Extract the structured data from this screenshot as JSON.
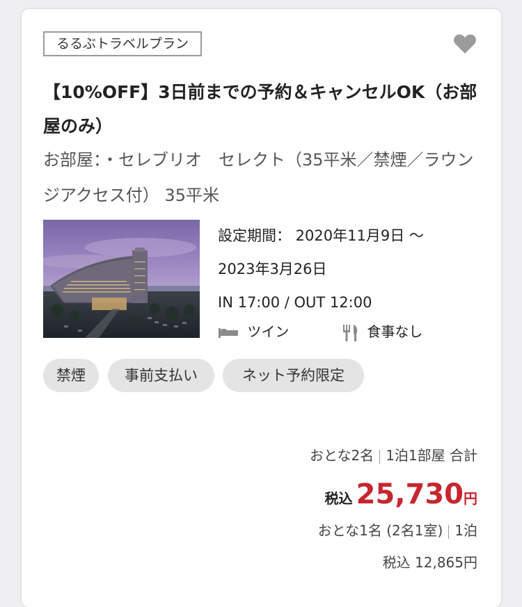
{
  "plan": {
    "tag": "るるぶトラベルプラン",
    "title": "【10%OFF】3日前までの予約＆キャンセルOK（お部屋のみ）",
    "room": "お部屋：・セレブリオ　セレクト（35平米／禁煙／ラウンジアクセス付） 35平米",
    "period_line1": "設定期間： 2020年11月9日 〜",
    "period_line2": "2023年3月26日",
    "checkin_out": "IN 17:00 / OUT 12:00",
    "bed_icon": "bed-icon",
    "bed_label": "ツイン",
    "meal_icon": "fork-knife-icon",
    "meal_label": "食事なし",
    "chips": [
      "禁煙",
      "事前支払い",
      "ネット予約限定"
    ]
  },
  "pricing": {
    "guests": "おとな2名",
    "stay": "1泊1部屋 合計",
    "tax_label": "税込",
    "total": "25,730",
    "currency": "円",
    "per_person_guests": "おとな1名 (2名1室)",
    "per_person_stay": "1泊",
    "per_person_price": "税込 12,865円"
  },
  "colors": {
    "price": "#c6262e",
    "heart": "#9b9b9b",
    "chip_bg": "#e4e4e4"
  }
}
